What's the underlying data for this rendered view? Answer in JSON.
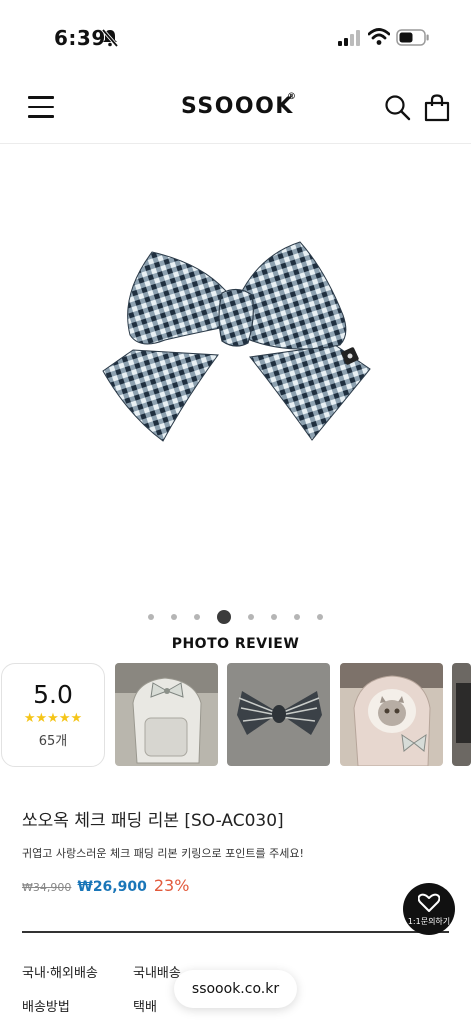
{
  "status_bar": {
    "time": "6:39"
  },
  "header": {
    "logo": "SSOOOK",
    "logo_mark": "®"
  },
  "photo_review": {
    "title": "PHOTO REVIEW",
    "rating": "5.0",
    "stars": "★★★★★",
    "count": "65개"
  },
  "product": {
    "title": "쏘오옥 체크 패딩 리본 [SO-AC030]",
    "description": "귀엽고 사랑스러운 체크 패딩 리본 키링으로 포인트를 주세요!",
    "price_original": "₩34,900",
    "price_sale": "₩26,900",
    "discount": "23%"
  },
  "shipping": {
    "row1_label": "국내·해외배송",
    "row1_value": "국내배송",
    "row2_label": "배송방법",
    "row2_value": "택배"
  },
  "floating": {
    "inquiry_label": "1:1문의하기",
    "url": "ssoook.co.kr"
  },
  "colors": {
    "accent_price": "#1a76b8",
    "discount": "#e25a3c",
    "star": "#f5c518"
  }
}
